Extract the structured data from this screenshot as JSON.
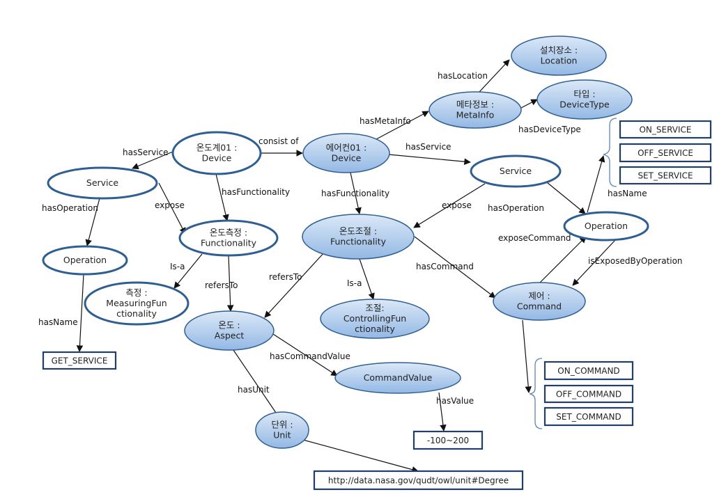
{
  "colors": {
    "node_border": "#2f5f92",
    "blue_fill_top": "#dbe8f7",
    "blue_fill_bottom": "#93b8e4",
    "white_fill": "#ffffff",
    "edge": "#111111"
  },
  "nodes": {
    "location": {
      "line1": "설치장소 :",
      "line2": "Location",
      "style": "blue"
    },
    "metainfo": {
      "line1": "메타정보 :",
      "line2": "MetaInfo",
      "style": "blue"
    },
    "devicetype": {
      "line1": "타입 :",
      "line2": "DeviceType",
      "style": "blue"
    },
    "thermometer": {
      "line1": "온도계01 :",
      "line2": "Device",
      "style": "white"
    },
    "aircon": {
      "line1": "에어컨01 :",
      "line2": "Device",
      "style": "blue"
    },
    "service_left": {
      "line1": "Service",
      "line2": "",
      "style": "white"
    },
    "service_right": {
      "line1": "Service",
      "line2": "",
      "style": "white"
    },
    "func_measure": {
      "line1": "온도측정 :",
      "line2": "Functionality",
      "style": "white"
    },
    "func_control": {
      "line1": "온도조절 :",
      "line2": "Functionality",
      "style": "blue"
    },
    "operation_left": {
      "line1": "Operation",
      "line2": "",
      "style": "white"
    },
    "operation_right": {
      "line1": "Operation",
      "line2": "",
      "style": "white"
    },
    "measuring": {
      "line1": "측정 :",
      "line2": "MeasuringFun",
      "line3": "ctionality",
      "style": "white"
    },
    "aspect": {
      "line1": "온도 :",
      "line2": "Aspect",
      "style": "blue"
    },
    "controlling": {
      "line1": "조절:",
      "line2": "ControllingFun",
      "line3": "ctionality",
      "style": "blue"
    },
    "command": {
      "line1": "제어 :",
      "line2": "Command",
      "style": "blue"
    },
    "commandvalue": {
      "line1": "CommandValue",
      "line2": "",
      "style": "blue"
    },
    "unit": {
      "line1": "단위 :",
      "line2": "Unit",
      "style": "blue"
    }
  },
  "boxes": {
    "get_service": "GET_SERVICE",
    "on_service": "ON_SERVICE",
    "off_service": "OFF_SERVICE",
    "set_service": "SET_SERVICE",
    "on_command": "ON_COMMAND",
    "off_command": "OFF_COMMAND",
    "set_command": "SET_COMMAND",
    "value_range": "-100~200",
    "unit_uri": "http://data.nasa.gov/qudt/owl/unit#Degree"
  },
  "edges": {
    "e1": "hasService",
    "e2": "consist of",
    "e3": "hasFunctionality",
    "e4": "expose",
    "e5": "hasOperation",
    "e6": "hasName",
    "e7": "Is-a",
    "e8": "refersTo",
    "e9": "hasMetaInfo",
    "e10": "hasLocation",
    "e11": "hasDeviceType",
    "e12": "hasService",
    "e13": "hasFunctionality",
    "e14": "expose",
    "e15": "hasOperation",
    "e16": "hasName",
    "e17": "refersTo",
    "e18": "Is-a",
    "e19": "hasCommand",
    "e20": "exposeCommand",
    "e21": "isExposedByOperation",
    "e23": "hasCommandValue",
    "e24": "hasUnit",
    "e25": "hasValue"
  }
}
